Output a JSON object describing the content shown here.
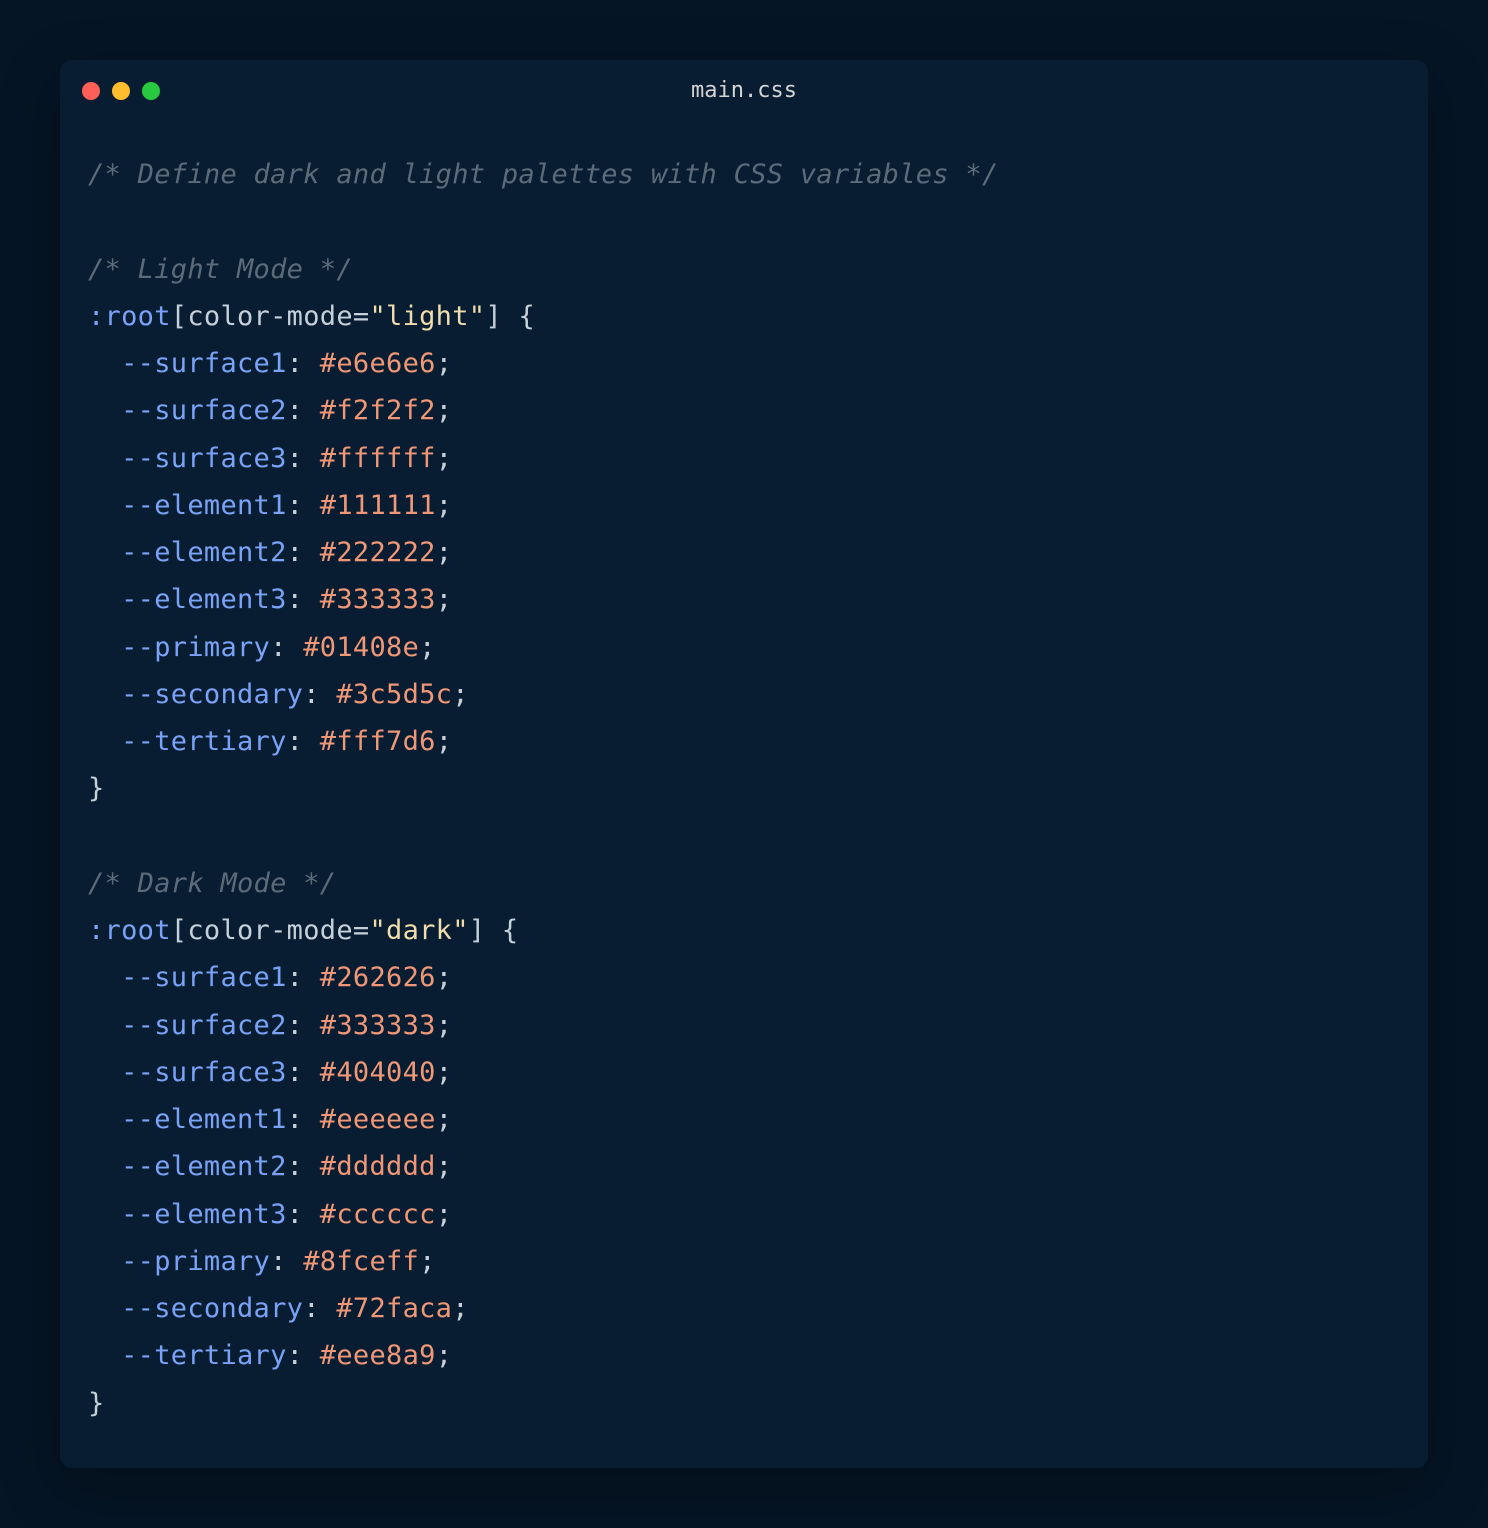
{
  "filename": "main.css",
  "code": {
    "comment1": "/* Define dark and light palettes with CSS variables */",
    "comment2": "/* Light Mode */",
    "pseudo": ":root",
    "attr_open": "[color-mode=",
    "light_str": "\"light\"",
    "attr_close": "]",
    "brace_open": " {",
    "brace_close": "}",
    "light": {
      "surface1_name": "  --surface1",
      "surface1_val": " #e6e6e6",
      "surface2_name": "  --surface2",
      "surface2_val": " #f2f2f2",
      "surface3_name": "  --surface3",
      "surface3_val": " #ffffff",
      "element1_name": "  --element1",
      "element1_val": " #111111",
      "element2_name": "  --element2",
      "element2_val": " #222222",
      "element3_name": "  --element3",
      "element3_val": " #333333",
      "primary_name": "  --primary",
      "primary_val": " #01408e",
      "secondary_name": "  --secondary",
      "secondary_val": " #3c5d5c",
      "tertiary_name": "  --tertiary",
      "tertiary_val": " #fff7d6"
    },
    "comment3": "/* Dark Mode */",
    "dark_str": "\"dark\"",
    "dark": {
      "surface1_name": "  --surface1",
      "surface1_val": " #262626",
      "surface2_name": "  --surface2",
      "surface2_val": " #333333",
      "surface3_name": "  --surface3",
      "surface3_val": " #404040",
      "element1_name": "  --element1",
      "element1_val": " #eeeeee",
      "element2_name": "  --element2",
      "element2_val": " #dddddd",
      "element3_name": "  --element3",
      "element3_val": " #cccccc",
      "primary_name": "  --primary",
      "primary_val": " #8fceff",
      "secondary_name": "  --secondary",
      "secondary_val": " #72faca",
      "tertiary_name": "  --tertiary",
      "tertiary_val": " #eee8a9"
    },
    "colon": ":",
    "semi": ";"
  }
}
